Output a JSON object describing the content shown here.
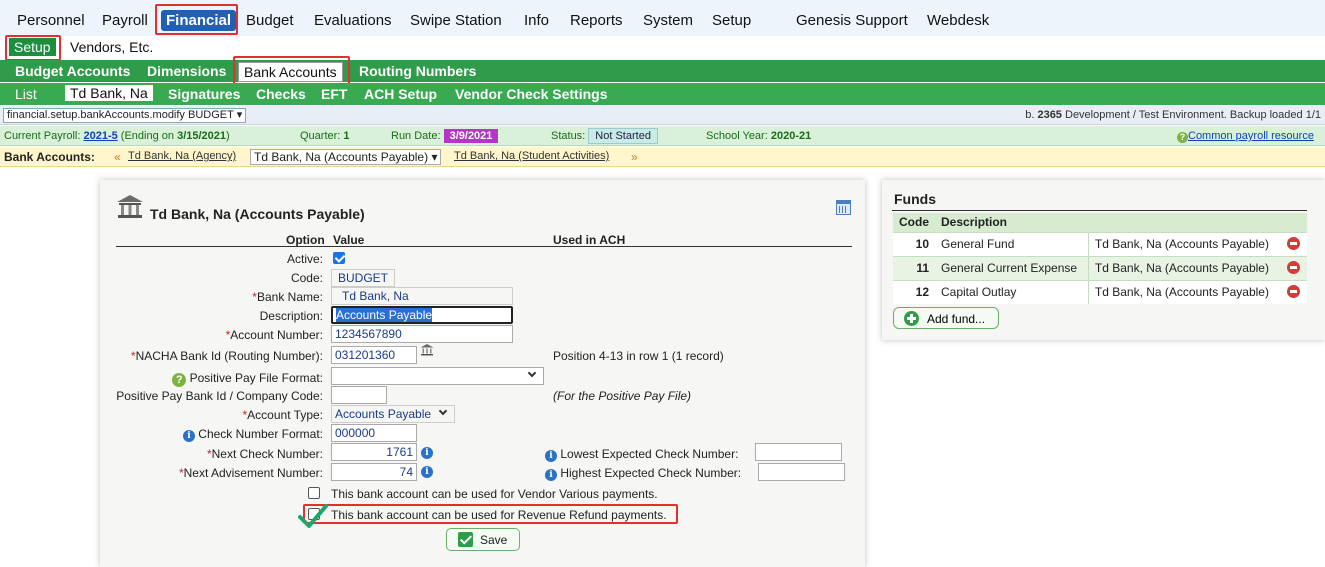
{
  "top_menu": {
    "personnel": "Personnel",
    "payroll": "Payroll",
    "financial": "Financial",
    "budget": "Budget",
    "evaluations": "Evaluations",
    "swipe_station": "Swipe Station",
    "info": "Info",
    "reports": "Reports",
    "system": "System",
    "setup": "Setup",
    "genesis_support": "Genesis Support",
    "webdesk": "Webdesk"
  },
  "sub_menu": {
    "setup": "Setup",
    "vendors": "Vendors, Etc."
  },
  "setup_menu": {
    "budget_accounts": "Budget Accounts",
    "dimensions": "Dimensions",
    "bank_accounts": "Bank Accounts",
    "routing_numbers": "Routing Numbers"
  },
  "bank_tabs": {
    "list": "List",
    "current": "Td Bank, Na",
    "signatures": "Signatures",
    "checks": "Checks",
    "eft": "EFT",
    "ach_setup": "ACH Setup",
    "vendor_check_settings": "Vendor Check Settings"
  },
  "path_bar": {
    "path": "financial.setup.bankAccounts.modify BUDGET",
    "build_prefix": "b. ",
    "build_number": "2365",
    "build_text": " Development / Test Environment. Backup loaded 1/1"
  },
  "payroll_bar": {
    "current_payroll_label": "Current Payroll: ",
    "current_payroll": "2021-5",
    "ending_label": " (Ending on ",
    "ending_date": "3/15/2021",
    "ending_close": ")",
    "quarter_label": "Quarter: ",
    "quarter": "1",
    "run_date_label": "Run Date: ",
    "run_date": "3/9/2021",
    "status_label": "Status: ",
    "status": "Not Started",
    "school_year_label": "School Year: ",
    "school_year": "2020-21",
    "resources_link": "Common payroll resource"
  },
  "bank_bar": {
    "label": "Bank Accounts:",
    "prev_arrow": "«",
    "agency": "Td Bank, Na (Agency)",
    "selected": "Td Bank, Na (Accounts Payable)",
    "student": "Td Bank, Na (Student Activities)",
    "next_arrow": "»"
  },
  "form": {
    "title": "Td Bank, Na (Accounts Payable)",
    "col_option": "Option",
    "col_value": "Value",
    "col_ach": "Used in ACH",
    "active_label": "Active:",
    "active_checked": true,
    "code_label": "Code:",
    "code": "BUDGET",
    "bank_name_label": "Bank Name:",
    "bank_name": "Td Bank, Na",
    "description_label": "Description:",
    "description": "Accounts Payable",
    "account_number_label": "Account Number:",
    "account_number": "1234567890",
    "nacha_label": "NACHA Bank Id (Routing Number):",
    "nacha": "031201360",
    "nacha_note": "Position 4-13 in row 1 (1 record)",
    "ppf_format_label": "Positive Pay File Format:",
    "ppf_format": "",
    "ppf_bank_id_label": "Positive Pay Bank Id / Company Code:",
    "ppf_bank_id": "",
    "ppf_note": "(For the Positive Pay File)",
    "account_type_label": "Account Type:",
    "account_type": "Accounts Payable",
    "check_format_label": "Check Number Format:",
    "check_format": "000000",
    "next_check_label": "Next Check Number:",
    "next_check": "1761",
    "lowest_check_label": "Lowest Expected Check Number:",
    "lowest_check": "",
    "next_advisement_label": "Next Advisement Number:",
    "next_advisement": "74",
    "highest_check_label": "Highest Expected Check Number:",
    "highest_check": "",
    "vendor_various_label": "This bank account can be used for Vendor Various payments.",
    "revenue_refund_label": "This bank account can be used for Revenue Refund payments.",
    "save_label": "Save"
  },
  "funds": {
    "title": "Funds",
    "col_code": "Code",
    "col_description": "Description",
    "rows": [
      {
        "code": "10",
        "description": "General Fund",
        "bank": "Td Bank, Na (Accounts Payable)"
      },
      {
        "code": "11",
        "description": "General Current Expense",
        "bank": "Td Bank, Na (Accounts Payable)"
      },
      {
        "code": "12",
        "description": "Capital Outlay",
        "bank": "Td Bank, Na (Accounts Payable)"
      }
    ],
    "add_label": "Add fund..."
  },
  "colors": {
    "active_menu": "#1f5fb8",
    "green_bar": "#2e9c4a",
    "highlight": "#e03030"
  },
  "icons": [
    "bank-icon",
    "calendar-icon",
    "help-icon",
    "info-icon",
    "delete-icon",
    "add-icon",
    "checkmark-icon"
  ]
}
